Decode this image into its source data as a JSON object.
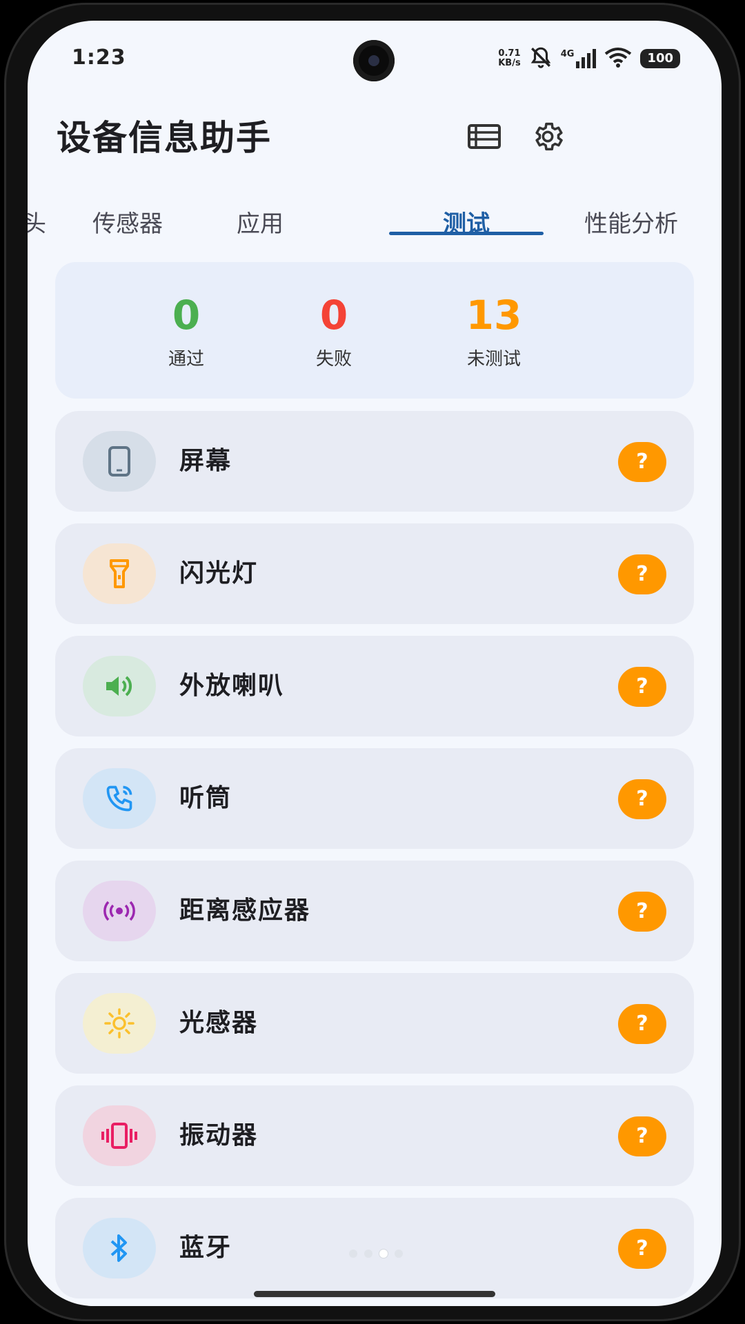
{
  "status_bar": {
    "time": "1:23",
    "net_speed_value": "0.71",
    "net_speed_unit": "KB/s",
    "network_type": "4G",
    "battery": "100"
  },
  "header": {
    "title": "设备信息助手"
  },
  "tabs": [
    {
      "label": "头",
      "active": false
    },
    {
      "label": "传感器",
      "active": false
    },
    {
      "label": "应用",
      "active": false
    },
    {
      "label": "测试",
      "active": true
    },
    {
      "label": "性能分析",
      "active": false
    }
  ],
  "summary": {
    "passed": {
      "value": "0",
      "label": "通过",
      "color": "#4caf50"
    },
    "failed": {
      "value": "0",
      "label": "失败",
      "color": "#f44336"
    },
    "untested": {
      "value": "13",
      "label": "未测试",
      "color": "#ff9800"
    }
  },
  "tests": [
    {
      "label": "屏幕",
      "icon": "phone-icon",
      "icon_color": "#5f7486",
      "icon_bg": "#d6dee8",
      "status": "?"
    },
    {
      "label": "闪光灯",
      "icon": "flashlight-icon",
      "icon_color": "#ff9800",
      "icon_bg": "#f6e5d3",
      "status": "?"
    },
    {
      "label": "外放喇叭",
      "icon": "speaker-icon",
      "icon_color": "#4caf50",
      "icon_bg": "#d8eadf",
      "status": "?"
    },
    {
      "label": "听筒",
      "icon": "phone-call-icon",
      "icon_color": "#2196f3",
      "icon_bg": "#d3e5f6",
      "status": "?"
    },
    {
      "label": "距离感应器",
      "icon": "proximity-icon",
      "icon_color": "#9c27b0",
      "icon_bg": "#e6d6ee",
      "status": "?"
    },
    {
      "label": "光感器",
      "icon": "sun-icon",
      "icon_color": "#fbc02d",
      "icon_bg": "#f4efd2",
      "status": "?"
    },
    {
      "label": "振动器",
      "icon": "vibration-icon",
      "icon_color": "#e91e63",
      "icon_bg": "#f1d4e0",
      "status": "?"
    },
    {
      "label": "蓝牙",
      "icon": "bluetooth-icon",
      "icon_color": "#2196f3",
      "icon_bg": "#d3e5f6",
      "status": "?"
    }
  ],
  "colors": {
    "accent": "#1f5fa5",
    "pending": "#ff9800"
  }
}
